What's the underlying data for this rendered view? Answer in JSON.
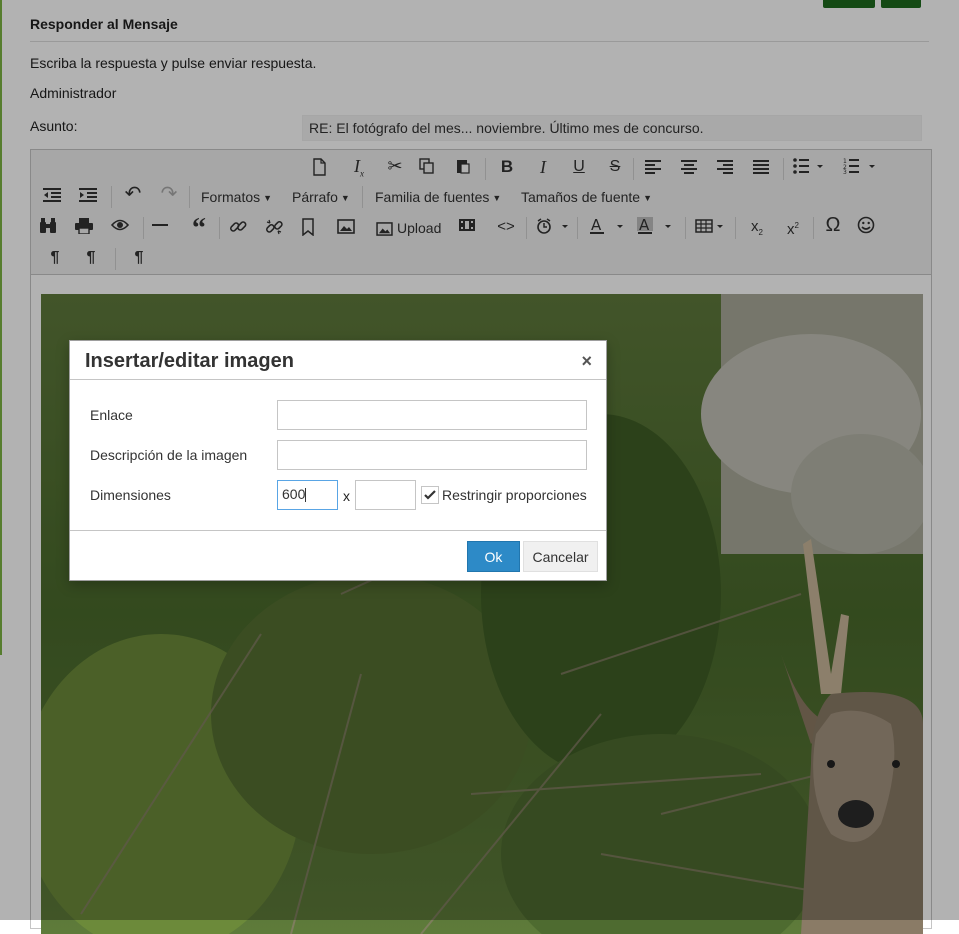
{
  "page": {
    "heading": "Responder al Mensaje",
    "instructions": "Escriba la respuesta y pulse enviar respuesta.",
    "recipient": "Administrador",
    "subject_label": "Asunto:",
    "subject_value": "RE: El fotógrafo del mes... noviembre. Último mes de concurso."
  },
  "toolbar": {
    "formats": "Formatos",
    "paragraph": "Párrafo",
    "font_family": "Familia de fuentes",
    "font_sizes": "Tamaños de fuente",
    "upload": "Upload",
    "omega": "Ω",
    "icons": [
      "new-document",
      "clear-format",
      "cut",
      "copy",
      "paste",
      "bold",
      "italic",
      "underline",
      "strikethrough",
      "align-left",
      "align-center",
      "align-right",
      "justify",
      "bullet-list",
      "numbered-list",
      "outdent",
      "indent",
      "undo",
      "redo",
      "find-replace",
      "print",
      "preview",
      "horizontal-rule",
      "blockquote",
      "link",
      "unlink",
      "anchor",
      "image",
      "upload",
      "media",
      "code",
      "insert-time",
      "text-color",
      "background-color",
      "table",
      "subscript",
      "superscript",
      "special-character",
      "emoticons",
      "ltr",
      "rtl",
      "paragraph-mark"
    ]
  },
  "dialog": {
    "title": "Insertar/editar imagen",
    "close": "×",
    "link_label": "Enlace",
    "link_value": "",
    "desc_label": "Descripción de la imagen",
    "desc_value": "",
    "dim_label": "Dimensiones",
    "width_value": "600",
    "height_value": "",
    "times": "x",
    "constrain_label": "Restringir proporciones",
    "constrain_checked": true,
    "ok": "Ok",
    "cancel": "Cancelar"
  },
  "colors": {
    "accent_green": "#1e6b1e",
    "ok_button": "#2d8ac7",
    "overlay": "rgba(0,0,0,0.3)"
  }
}
